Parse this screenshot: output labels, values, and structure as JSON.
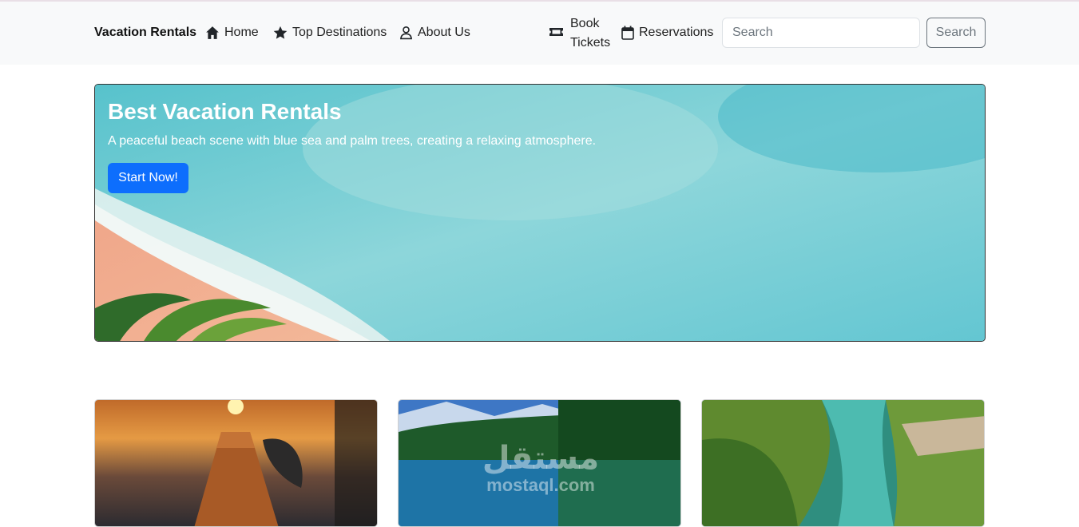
{
  "navbar": {
    "brand": "Vacation Rentals",
    "links": [
      {
        "label": "Home",
        "icon": "house-icon"
      },
      {
        "label": "Top Destinations",
        "icon": "star-icon"
      },
      {
        "label": "About Us",
        "icon": "person-icon"
      }
    ],
    "book": {
      "line1": "Book",
      "line2": "Tickets",
      "icon": "ticket-icon"
    },
    "reservations": {
      "label": "Reservations",
      "icon": "calendar-icon"
    },
    "search": {
      "placeholder": "Search",
      "button_label": "Search"
    }
  },
  "hero": {
    "title": "Best Vacation Rentals",
    "subtitle": "A peaceful beach scene with blue sea and palm trees, creating a relaxing atmosphere.",
    "button_label": "Start Now!"
  },
  "watermark": {
    "arabic": "مستقل",
    "latin": "mostaql.com"
  },
  "colors": {
    "primary": "#0d6efd",
    "navbar_bg": "#f8f9fa",
    "outline_secondary": "#6c757d"
  }
}
